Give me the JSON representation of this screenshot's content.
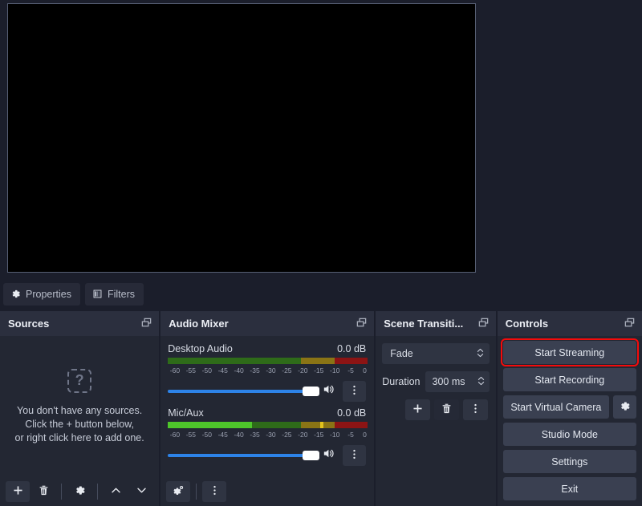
{
  "preview": {
    "name": "program-preview",
    "background": "#000000"
  },
  "source_toolbar": {
    "properties_label": "Properties",
    "filters_label": "Filters",
    "properties_icon": "gear-icon",
    "filters_icon": "filters-icon"
  },
  "sources": {
    "title": "Sources",
    "float_icon": "undock-icon",
    "empty_icon": "question-mark-icon",
    "empty_icon_glyph": "?",
    "empty_line1": "You don't have any sources.",
    "empty_line2": "Click the + button below,",
    "empty_line3": "or right click here to add one.",
    "toolbar": [
      {
        "name": "add-source-button",
        "icon": "plus-icon"
      },
      {
        "name": "remove-source-button",
        "icon": "trash-icon"
      },
      {
        "name": "source-properties-button",
        "icon": "gear-icon"
      },
      {
        "name": "move-source-up-button",
        "icon": "chevron-up-icon"
      },
      {
        "name": "move-source-down-button",
        "icon": "chevron-down-icon"
      }
    ]
  },
  "mixer": {
    "title": "Audio Mixer",
    "float_icon": "undock-icon",
    "tick_labels": [
      "-60",
      "-55",
      "-50",
      "-45",
      "-40",
      "-35",
      "-30",
      "-25",
      "-20",
      "-15",
      "-10",
      "-5",
      "0"
    ],
    "channels": [
      {
        "name": "Desktop Audio",
        "db": "0.0 dB",
        "level_pct": 0,
        "volume_pct": 100,
        "speaker_icon": "speaker-icon",
        "menu_icon": "kebab-menu-icon"
      },
      {
        "name": "Mic/Aux",
        "db": "0.0 dB",
        "level_pct": 42,
        "volume_pct": 100,
        "speaker_icon": "speaker-icon",
        "menu_icon": "kebab-menu-icon"
      }
    ],
    "toolbar": [
      {
        "name": "advanced-audio-properties-button",
        "icon": "gears-icon"
      },
      {
        "name": "mixer-menu-button",
        "icon": "kebab-menu-icon"
      }
    ],
    "colors": {
      "green": "#4ec62b",
      "yellow": "#e2c21c",
      "red": "#8c1414",
      "slider": "#2d83e8"
    }
  },
  "transitions": {
    "title": "Scene Transiti...",
    "float_icon": "undock-icon",
    "selected_transition": "Fade",
    "duration_label": "Duration",
    "duration_value": "300 ms",
    "buttons": [
      {
        "name": "add-transition-button",
        "icon": "plus-icon"
      },
      {
        "name": "remove-transition-button",
        "icon": "trash-icon"
      },
      {
        "name": "transition-menu-button",
        "icon": "kebab-menu-icon"
      }
    ]
  },
  "controls": {
    "title": "Controls",
    "float_icon": "undock-icon",
    "start_streaming": "Start Streaming",
    "start_recording": "Start Recording",
    "start_virtual_camera": "Start Virtual Camera",
    "virtual_camera_settings_icon": "gear-icon",
    "studio_mode": "Studio Mode",
    "settings": "Settings",
    "exit": "Exit",
    "highlight_color": "#f40b0b"
  }
}
